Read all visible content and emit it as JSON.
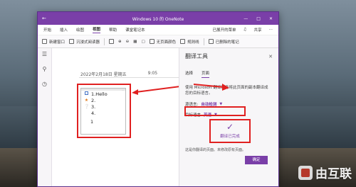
{
  "window": {
    "title": "Windows 10 的 OneNote",
    "titlebar_icons": [
      "back-icon",
      "window-controls"
    ]
  },
  "menu": {
    "tabs": [
      "开始",
      "插入",
      "绘图",
      "视图",
      "帮助",
      "课堂笔记本"
    ],
    "active_tab": "视图",
    "right_items": [
      "已展开的菜单",
      "共享",
      "更多"
    ]
  },
  "toolbar": {
    "buttons": [
      "新建窗口",
      "沉浸式阅读器",
      "缩放",
      "放大",
      "缩小",
      "100%",
      "页宽",
      "无页面颜色",
      "规则线",
      "打印",
      "已删除的笔记"
    ]
  },
  "page": {
    "date": "2022年2月18日 星期五",
    "time": "9:05",
    "note_items": [
      {
        "marker": "checkbox",
        "text": "1.Hello"
      },
      {
        "marker": "star",
        "text": "2."
      },
      {
        "marker": "question",
        "text": "3."
      },
      {
        "marker": "none",
        "text": "4."
      }
    ],
    "note_last": "1"
  },
  "pane": {
    "title": "翻译工具",
    "tabs": [
      "选择",
      "页面"
    ],
    "active_tab": "页面",
    "description": "使用 Microsoft 翻译服务将此页面的副本翻译成您的目标语言。",
    "source_label": "源语言:",
    "source_value": "自动检测",
    "target_label": "目标语言",
    "target_value": "英语",
    "done_text": "翻译已完成",
    "note": "这是你翻译的页面。未修改原有页面。",
    "cancel_label": "确定"
  },
  "watermark": {
    "text": "由互联"
  },
  "colors": {
    "accent": "#7a3fa8",
    "highlight": "#e02020"
  }
}
